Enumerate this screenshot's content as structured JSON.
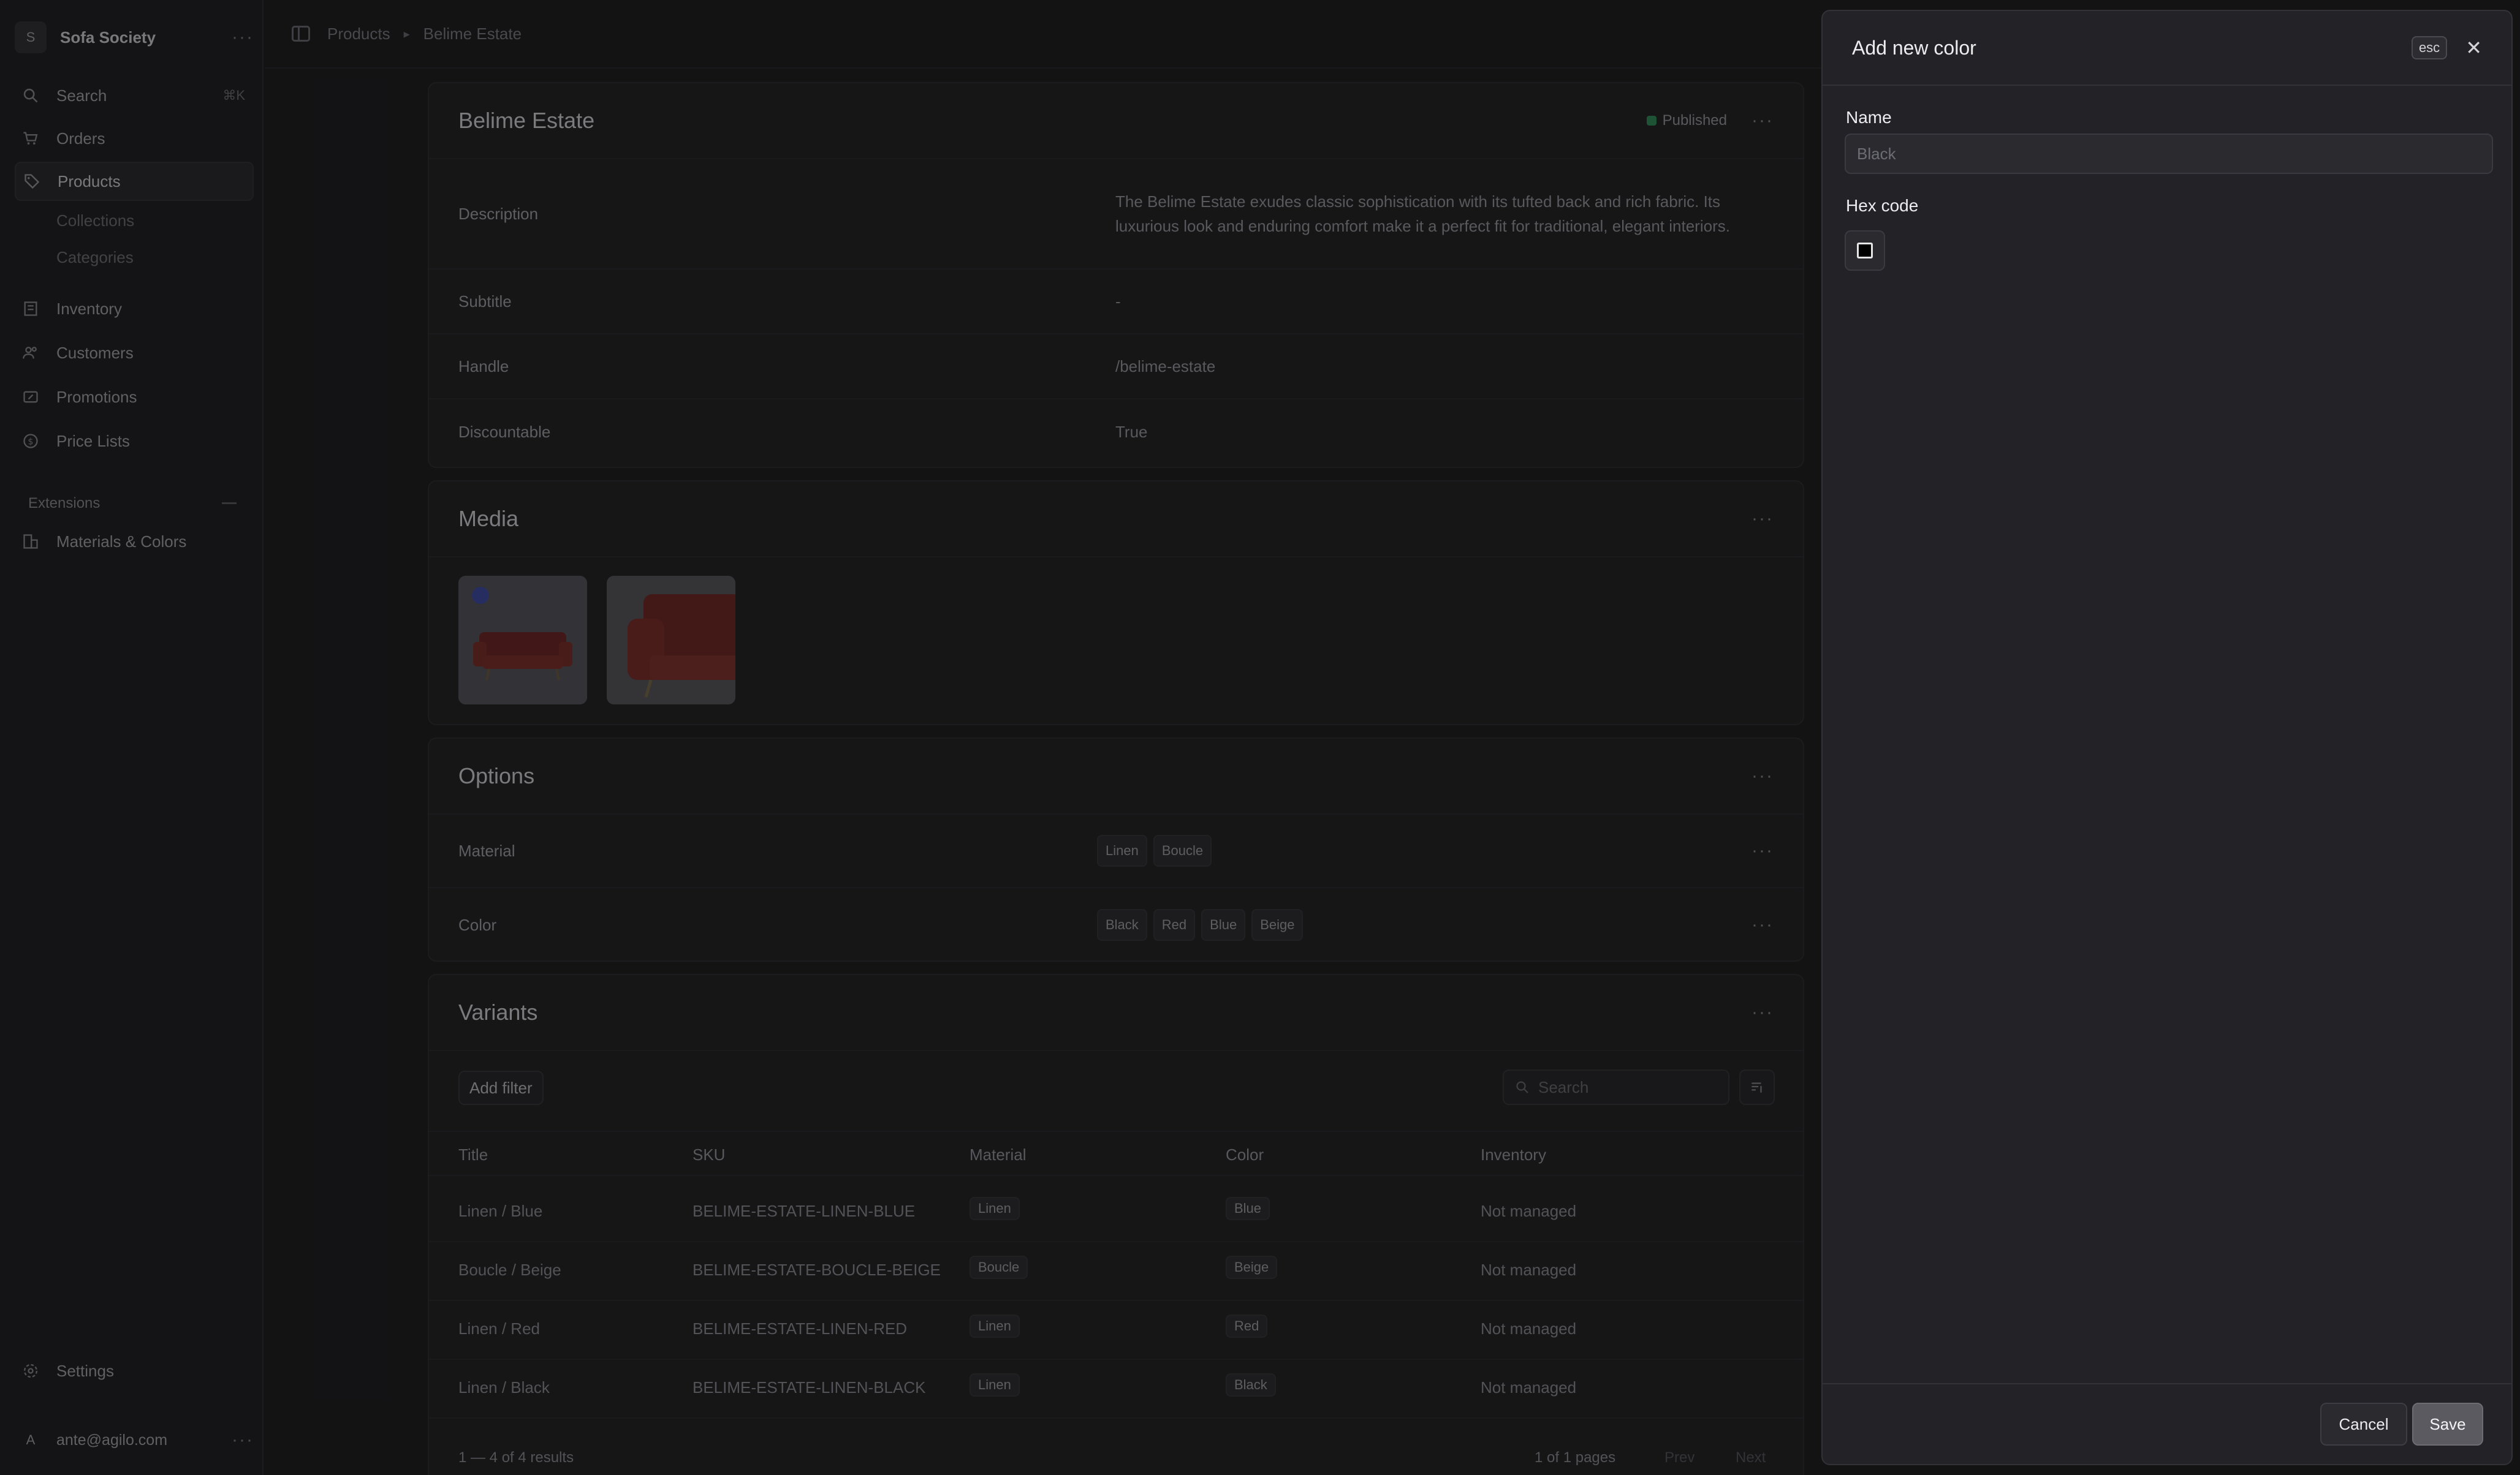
{
  "sidebar": {
    "store_initial": "S",
    "store_name": "Sofa Society",
    "search_label": "Search",
    "search_shortcut": "⌘K",
    "nav": {
      "orders": "Orders",
      "products": "Products",
      "collections": "Collections",
      "categories": "Categories",
      "inventory": "Inventory",
      "customers": "Customers",
      "promotions": "Promotions",
      "price_lists": "Price Lists"
    },
    "extensions_label": "Extensions",
    "materials_colors": "Materials & Colors",
    "settings": "Settings",
    "user_initial": "A",
    "user_email": "ante@agilo.com"
  },
  "breadcrumb": {
    "products": "Products",
    "current": "Belime Estate"
  },
  "product": {
    "title": "Belime Estate",
    "status": "Published",
    "fields": {
      "description_label": "Description",
      "description_value": "The Belime Estate exudes classic sophistication with its tufted back and rich fabric. Its luxurious look and enduring comfort make it a perfect fit for traditional, elegant interiors.",
      "subtitle_label": "Subtitle",
      "subtitle_value": "-",
      "handle_label": "Handle",
      "handle_value": "/belime-estate",
      "discountable_label": "Discountable",
      "discountable_value": "True"
    }
  },
  "media": {
    "title": "Media"
  },
  "options": {
    "title": "Options",
    "material_label": "Material",
    "material_values": [
      "Linen",
      "Boucle"
    ],
    "color_label": "Color",
    "color_values": [
      "Black",
      "Red",
      "Blue",
      "Beige"
    ]
  },
  "variants": {
    "title": "Variants",
    "add_filter": "Add filter",
    "search_placeholder": "Search",
    "columns": [
      "Title",
      "SKU",
      "Material",
      "Color",
      "Inventory"
    ],
    "rows": [
      [
        "Linen / Blue",
        "BELIME-ESTATE-LINEN-BLUE",
        "Linen",
        "Blue",
        "Not managed"
      ],
      [
        "Boucle / Beige",
        "BELIME-ESTATE-BOUCLE-BEIGE",
        "Boucle",
        "Beige",
        "Not managed"
      ],
      [
        "Linen / Red",
        "BELIME-ESTATE-LINEN-RED",
        "Linen",
        "Red",
        "Not managed"
      ],
      [
        "Linen / Black",
        "BELIME-ESTATE-LINEN-BLACK",
        "Linen",
        "Black",
        "Not managed"
      ]
    ],
    "results": "1 — 4 of 4 results",
    "pages": "1 of 1 pages",
    "prev": "Prev",
    "next": "Next"
  },
  "drawer": {
    "title": "Add new color",
    "esc": "esc",
    "name_label": "Name",
    "name_placeholder": "Black",
    "hex_label": "Hex code",
    "hex_value_color": "#000000",
    "cancel": "Cancel",
    "save": "Save"
  },
  "colors": {
    "status_published": "#2f8f5a",
    "sofa_red": "#8a2a26"
  }
}
